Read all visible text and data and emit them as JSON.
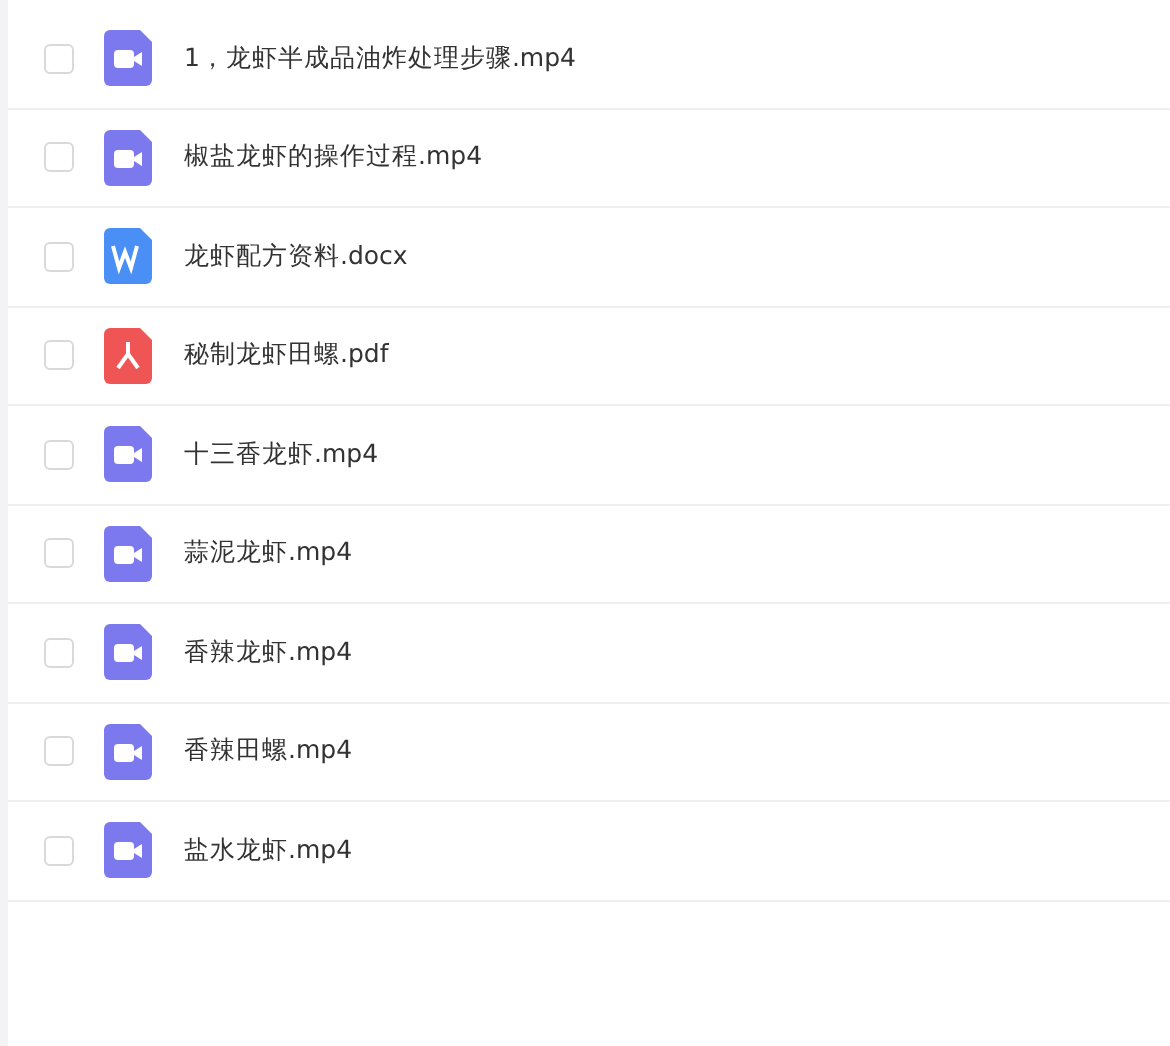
{
  "files": [
    {
      "name": "1，龙虾半成品油炸处理步骤.mp4",
      "kind": "video",
      "checked": false
    },
    {
      "name": "椒盐龙虾的操作过程.mp4",
      "kind": "video",
      "checked": false
    },
    {
      "name": "龙虾配方资料.docx",
      "kind": "word",
      "checked": false
    },
    {
      "name": "秘制龙虾田螺.pdf",
      "kind": "pdf",
      "checked": false
    },
    {
      "name": "十三香龙虾.mp4",
      "kind": "video",
      "checked": false
    },
    {
      "name": "蒜泥龙虾.mp4",
      "kind": "video",
      "checked": false
    },
    {
      "name": "香辣龙虾.mp4",
      "kind": "video",
      "checked": false
    },
    {
      "name": "香辣田螺.mp4",
      "kind": "video",
      "checked": false
    },
    {
      "name": "盐水龙虾.mp4",
      "kind": "video",
      "checked": false
    }
  ]
}
